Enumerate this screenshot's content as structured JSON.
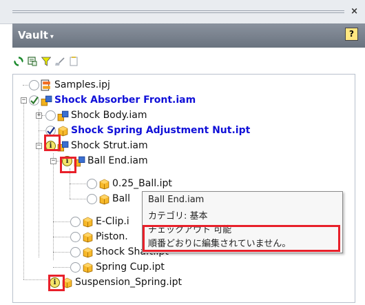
{
  "window": {
    "close_glyph": "×"
  },
  "panel": {
    "title": "Vault",
    "menu_caret": "▾",
    "help_label": "?"
  },
  "toolbar": {
    "buttons": [
      {
        "name": "refresh-icon"
      },
      {
        "name": "properties-icon"
      },
      {
        "name": "filter-icon"
      },
      {
        "name": "broom-icon"
      },
      {
        "name": "document-icon"
      }
    ]
  },
  "tree": {
    "samples": {
      "label": "Samples.ipj"
    },
    "shock_absorber_front": {
      "label": "Shock Absorber Front.iam"
    },
    "shock_body": {
      "label": "Shock Body.iam"
    },
    "shock_spring_nut": {
      "label": "Shock Spring Adjustment Nut.ipt"
    },
    "shock_strut": {
      "label": "Shock Strut.iam"
    },
    "ball_end": {
      "label": "Ball End.iam"
    },
    "ball_025": {
      "label": "0.25_Ball.ipt"
    },
    "ball_partial": {
      "label": "Ball"
    },
    "eclip": {
      "label": "E-Clip.i"
    },
    "piston": {
      "label": "Piston."
    },
    "shock_shaft": {
      "label": "Shock Shaft.ipt"
    },
    "spring_cup": {
      "label": "Spring Cup.ipt"
    },
    "suspension_spring": {
      "label": "Suspension_Spring.ipt"
    }
  },
  "tooltip": {
    "line1": "Ball End.iam",
    "line2": "カテゴリ: 基本",
    "line3": "チェックアウト 可能",
    "line4": "順番どおりに編集されていません。"
  },
  "colors": {
    "active_link": "#1010d8",
    "highlight_red": "#e8202a",
    "header_gray": "#7a838f"
  }
}
